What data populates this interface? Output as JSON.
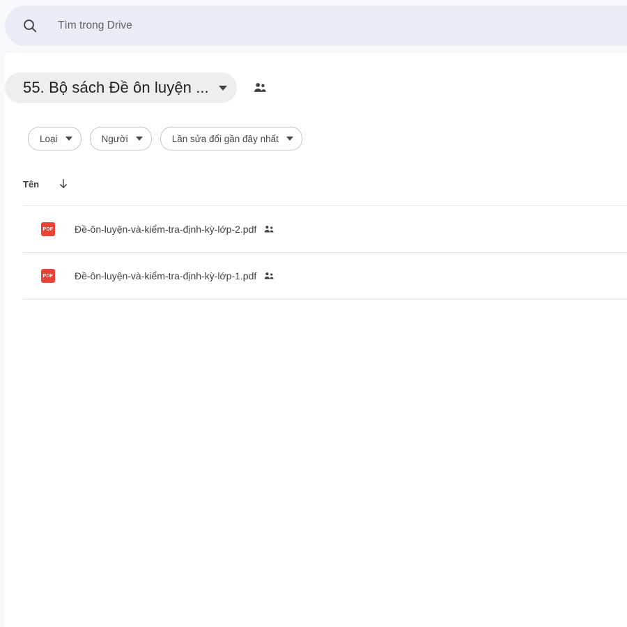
{
  "search": {
    "icon": "search-icon",
    "placeholder": "Tìm trong Drive",
    "value": ""
  },
  "header": {
    "title": "55. Bộ sách Đề ôn luyện ...",
    "caret_icon": "chevron-down-icon",
    "shared_icon": "people-icon"
  },
  "filters": [
    {
      "label": "Loại",
      "caret_icon": "chevron-down-icon"
    },
    {
      "label": "Người",
      "caret_icon": "chevron-down-icon"
    },
    {
      "label": "Lần sửa đổi gần đây nhất",
      "caret_icon": "chevron-down-icon"
    }
  ],
  "list": {
    "column_name": "Tên",
    "sort_icon": "arrow-down-icon",
    "files": [
      {
        "name": "Đề-ôn-luyện-và-kiểm-tra-định-kỳ-lớp-2.pdf",
        "type_label": "PDF",
        "type_icon": "pdf-file-icon",
        "shared_icon": "shared-people-icon"
      },
      {
        "name": "Đề-ôn-luyện-và-kiểm-tra-định-kỳ-lớp-1.pdf",
        "type_label": "PDF",
        "type_icon": "pdf-file-icon",
        "shared_icon": "shared-people-icon"
      }
    ]
  },
  "colors": {
    "page_background": "#f8f9fd",
    "search_background": "#e9edf6",
    "title_chip_background": "#eeeeee",
    "pdf_red": "#ea4335",
    "text_primary": "#202124",
    "text_secondary": "#5f6368",
    "divider": "#e3e3e3"
  }
}
